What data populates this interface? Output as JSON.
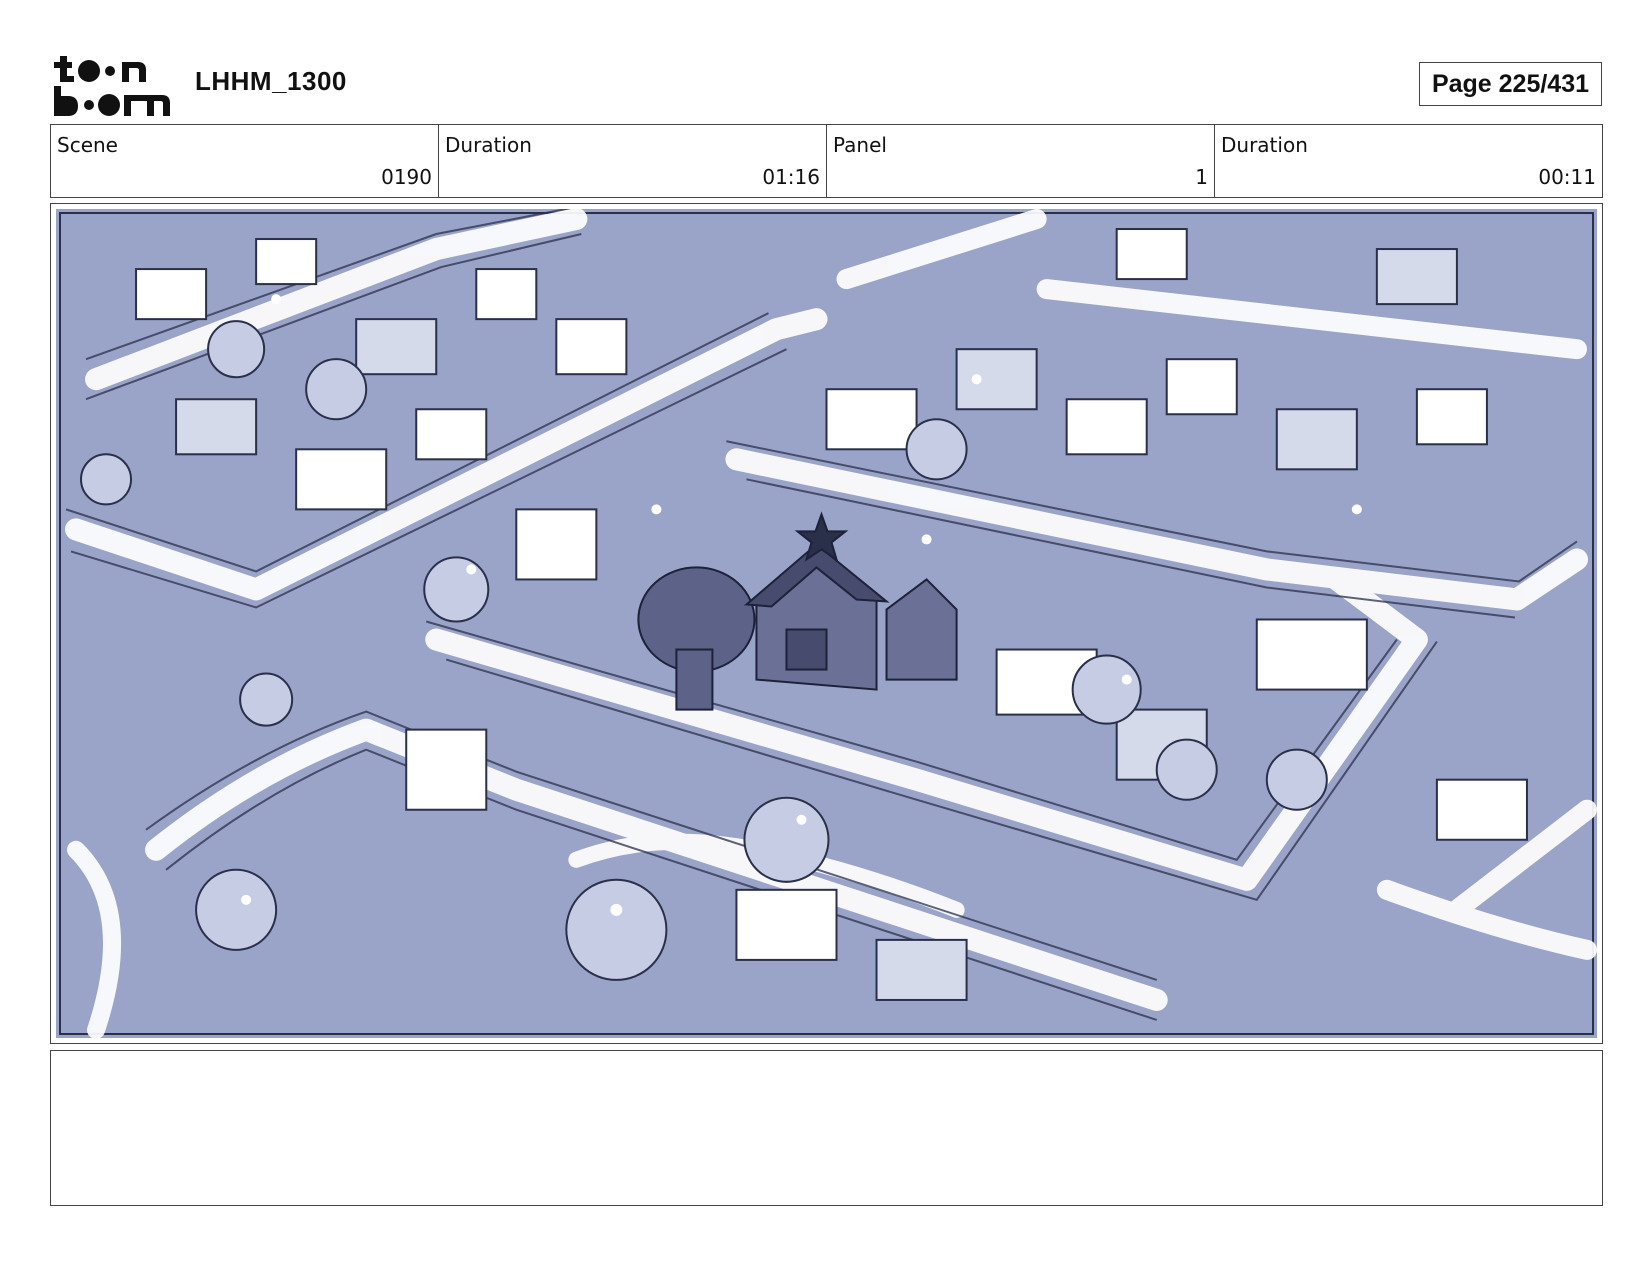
{
  "header": {
    "logo_text": "toon boom",
    "project_title": "LHHM_1300",
    "page_label": "Page 225/431"
  },
  "info_fields": [
    {
      "label": "Scene",
      "value": "0190"
    },
    {
      "label": "Duration",
      "value": "01:16"
    },
    {
      "label": "Panel",
      "value": "1"
    },
    {
      "label": "Duration",
      "value": "00:11"
    }
  ],
  "notes": {
    "text": ""
  },
  "colors": {
    "panel_fill": "#9aa4c8",
    "line_art": "#2a2f4a",
    "highlight": "#ffffff",
    "focus_house": "#5c6288"
  }
}
